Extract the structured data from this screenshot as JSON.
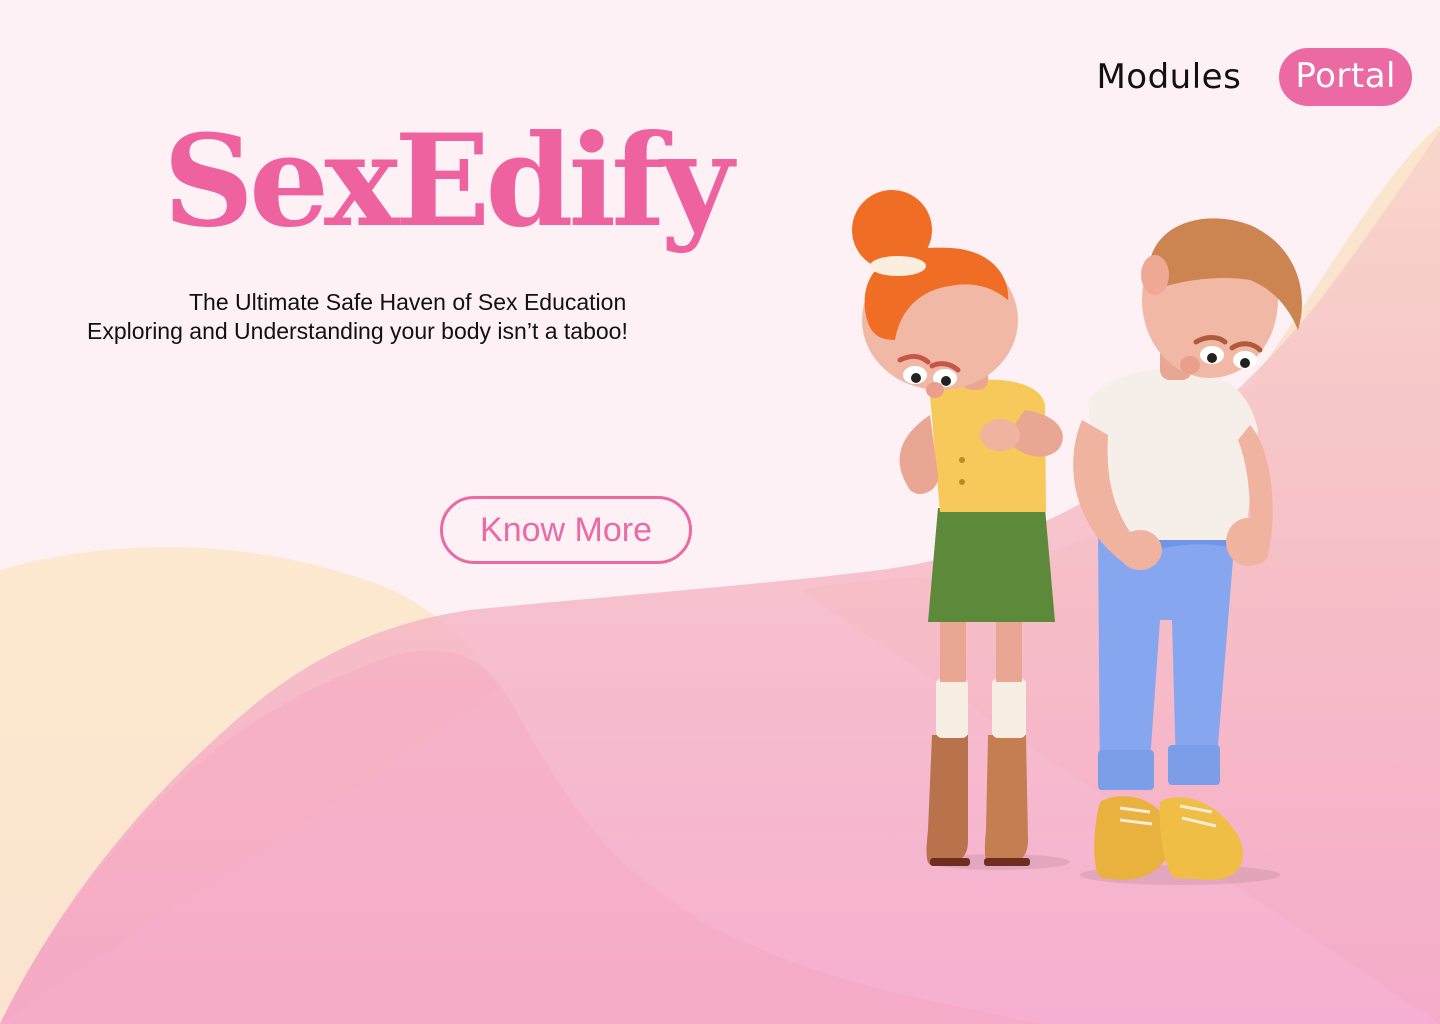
{
  "nav": {
    "modules_label": "Modules",
    "portal_label": "Portal"
  },
  "hero": {
    "brand": "SexEdify",
    "tagline": "The Ultimate Safe Haven of Sex Education",
    "subline": "Exploring and Understanding your body isn’t a taboo!",
    "cta_label": "Know More"
  },
  "colors": {
    "brand_pink": "#ee639f",
    "background": "#fdf1f6",
    "wave_peach": "#fbe7cf",
    "wave_pink": "#f5a6c8"
  },
  "illustration": {
    "icon": "two-people-looking-at-bodies-illustration"
  }
}
